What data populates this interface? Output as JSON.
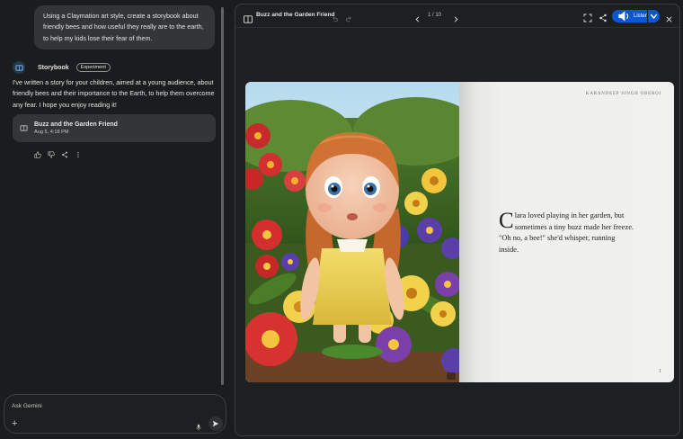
{
  "chat": {
    "user_prompt": "Using a Claymation art style, create a storybook about friendly bees and how useful they really are to the earth, to help my kids lose their fear of them.",
    "bot_name": "Storybook",
    "bot_badge": "Experiment",
    "bot_message": "I've written a story for your children, aimed at a young audience, about friendly bees and their importance to the Earth, to help them overcome any fear. I hope you enjoy reading it!",
    "card_title": "Buzz and the Garden Friend",
    "card_date": "Aug 5, 4:18 PM",
    "input_placeholder": "Ask Gemini"
  },
  "viewer": {
    "title": "Buzz and the Garden Friend",
    "pager": "1 / 10",
    "listen_label": "Listen"
  },
  "book": {
    "author": "KARANDEEP SINGH OBEROI",
    "drop_cap": "C",
    "story_text": "lara loved playing in her garden, but sometimes a tiny buzz made her freeze. \"Oh no, a bee!\" she'd whisper, running inside.",
    "page_number": "1"
  },
  "colors": {
    "accent": "#0b57d0",
    "background": "#1b1c1d",
    "bubble": "#333537"
  },
  "icons": [
    "storybook-icon",
    "book-icon",
    "undo-icon",
    "redo-icon",
    "chevron-left-icon",
    "chevron-right-icon",
    "fullscreen-icon",
    "share-icon",
    "speaker-icon",
    "chevron-down-icon",
    "close-icon",
    "thumb-up-icon",
    "thumb-down-icon",
    "more-icon",
    "plus-icon",
    "mic-icon",
    "send-icon",
    "image-icon"
  ]
}
